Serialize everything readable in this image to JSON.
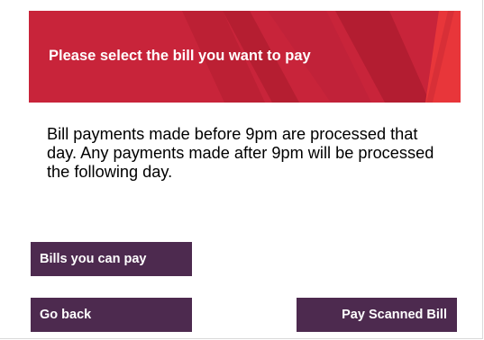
{
  "header": {
    "title": "Please select the bill you want to pay"
  },
  "main": {
    "notice": "Bill payments made before 9pm are processed that day. Any payments made after 9pm will be processed the following day."
  },
  "actions": {
    "bills_label": "Bills you can pay",
    "back_label": "Go back",
    "scan_label": "Pay Scanned Bill"
  },
  "colors": {
    "banner": "#c8243a",
    "banner_accent": "#e8363a",
    "button": "#4d2a4f",
    "button_text": "#ffffff"
  }
}
